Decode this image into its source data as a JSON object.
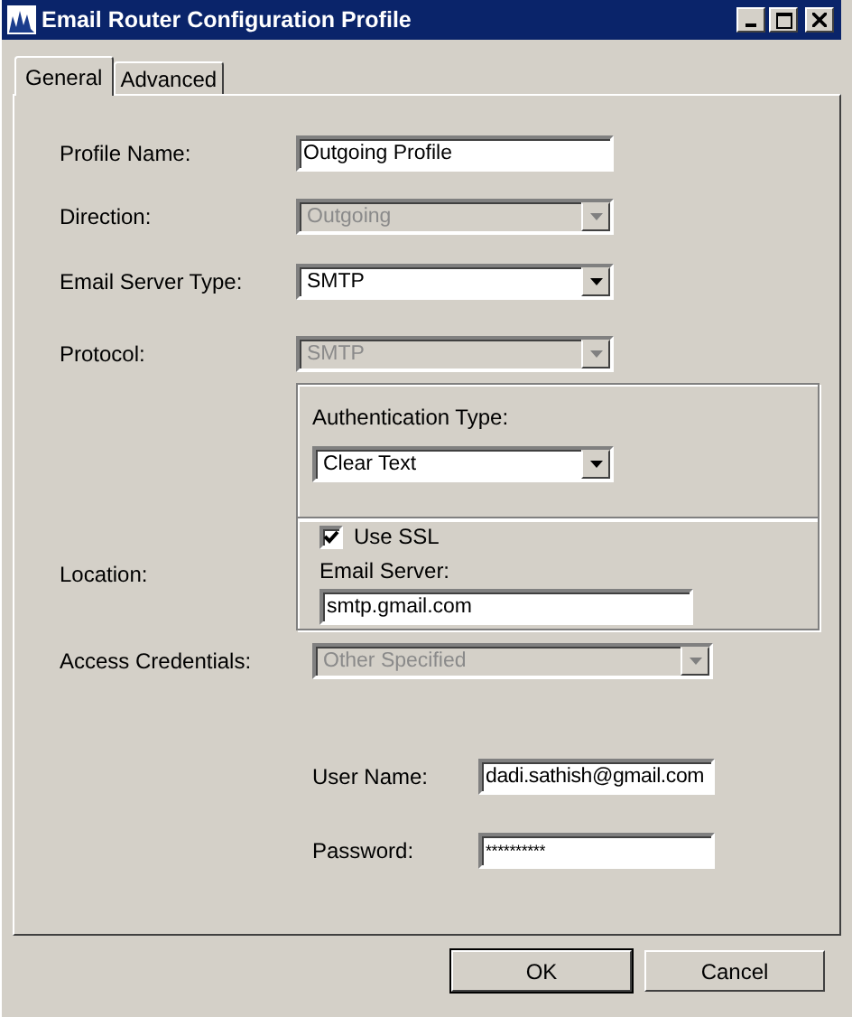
{
  "window": {
    "title": "Email Router Configuration Profile"
  },
  "tabs": [
    {
      "label": "General",
      "selected": true
    },
    {
      "label": "Advanced",
      "selected": false
    }
  ],
  "profile_name": {
    "label": "Profile Name:",
    "value": "Outgoing Profile"
  },
  "direction": {
    "label": "Direction:",
    "value": "Outgoing",
    "disabled": true
  },
  "email_server_type": {
    "label": "Email Server Type:",
    "value": "SMTP",
    "disabled": false
  },
  "protocol": {
    "label": "Protocol:",
    "value": "SMTP",
    "disabled": true
  },
  "authentication_type": {
    "label": "Authentication Type:",
    "value": "Clear Text",
    "disabled": false
  },
  "location": {
    "label": "Location:",
    "use_ssl": {
      "label": "Use SSL",
      "checked": true
    },
    "email_server": {
      "label": "Email Server:",
      "value": "smtp.gmail.com"
    }
  },
  "access_credentials": {
    "label": "Access Credentials:",
    "value": "Other Specified",
    "disabled": true
  },
  "user_name": {
    "label": "User Name:",
    "value": "dadi.sathish@gmail.com"
  },
  "password": {
    "label": "Password:",
    "value": "**********"
  },
  "buttons": [
    {
      "label": "OK",
      "default": true
    },
    {
      "label": "Cancel",
      "default": false
    }
  ]
}
